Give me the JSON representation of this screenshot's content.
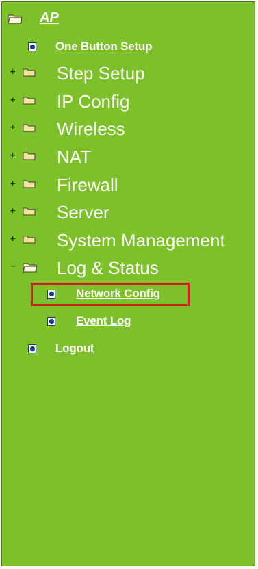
{
  "root": {
    "label": "AP"
  },
  "items": {
    "one_button": "One Button Setup",
    "step_setup": "Step Setup",
    "ip_config": "IP Config",
    "wireless": "Wireless",
    "nat": "NAT",
    "firewall": "Firewall",
    "server": "Server",
    "system_management": "System Management",
    "log_status": "Log & Status",
    "network_config": "Network Config",
    "event_log": "Event Log",
    "logout": "Logout"
  },
  "expander": {
    "collapsed": "+",
    "expanded": "−"
  },
  "colors": {
    "panel": "#7dc12a",
    "highlight": "#d61f1f"
  }
}
